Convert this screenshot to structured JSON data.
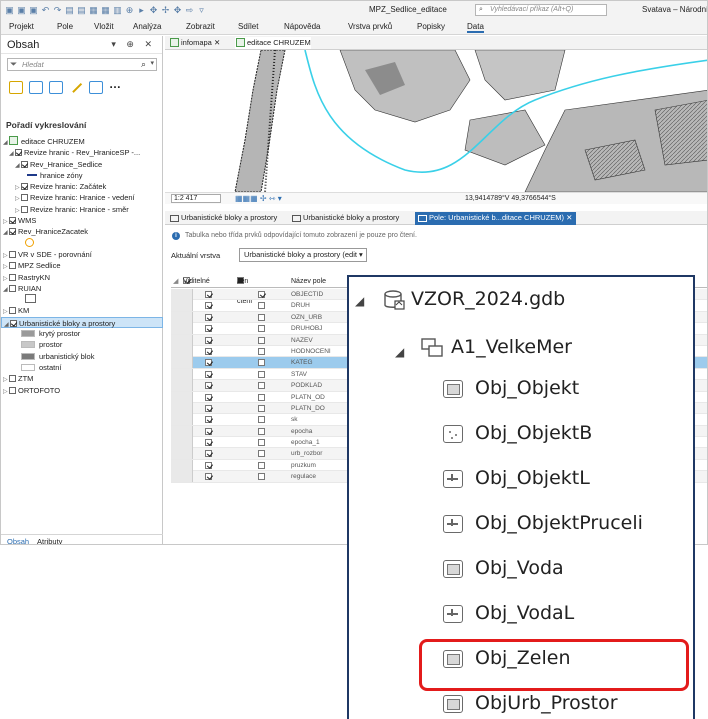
{
  "app": {
    "title": "MPZ_Sedlice_editace",
    "search_placeholder": "Vyhledávací příkaz (Alt+Q)",
    "user": "Svatava – Národní p"
  },
  "menu": [
    "Projekt",
    "Pole",
    "Vložit",
    "Analýza",
    "Zobrazit",
    "Sdílet",
    "Nápověda",
    "Vrstva prvků",
    "Popisky",
    "Data"
  ],
  "contents": {
    "title": "Obsah",
    "controls": "▾ ⊕ ✕",
    "search_placeholder": "Hledat",
    "draw_order": "Pořadí vykreslování",
    "tree": [
      {
        "label": "editace CHRUZEM",
        "indent": 0,
        "arrow": "◢",
        "cb": null,
        "icon": "map"
      },
      {
        "label": "Revize hranic - Rev_HraniceSP -...",
        "indent": 1,
        "arrow": "◢",
        "cb": true
      },
      {
        "label": "Rev_Hranice_Sedlice",
        "indent": 2,
        "arrow": "◢",
        "cb": true
      },
      {
        "label": "hranice zóny",
        "indent": 3,
        "arrow": "",
        "cb": null,
        "icon": "dash"
      },
      {
        "label": "Revize hranic: Začátek",
        "indent": 2,
        "arrow": "▷",
        "cb": true
      },
      {
        "label": "Revize hranic: Hranice - vedení",
        "indent": 2,
        "arrow": "▷",
        "cb": false
      },
      {
        "label": "Revize hranic: Hranice - směr",
        "indent": 2,
        "arrow": "▷",
        "cb": false
      },
      {
        "label": "WMS",
        "indent": 0,
        "arrow": "▷",
        "cb": true
      },
      {
        "label": "Rev_HraniceZacatek",
        "indent": 0,
        "arrow": "◢",
        "cb": true
      },
      {
        "label": "",
        "indent": 2,
        "arrow": "",
        "cb": null,
        "icon": "circle"
      },
      {
        "label": "VR v SDE - porovnání",
        "indent": 0,
        "arrow": "▷",
        "cb": false
      },
      {
        "label": "MPZ Sedlice",
        "indent": 0,
        "arrow": "▷",
        "cb": false
      },
      {
        "label": "RastryKN",
        "indent": 0,
        "arrow": "▷",
        "cb": false
      },
      {
        "label": "RUIAN",
        "indent": 0,
        "arrow": "◢",
        "cb": false
      },
      {
        "label": "",
        "indent": 2,
        "arrow": "",
        "cb": null,
        "icon": "square"
      },
      {
        "label": "KM",
        "indent": 0,
        "arrow": "▷",
        "cb": false
      },
      {
        "label": "Urbanistické bloky a prostory",
        "indent": 0,
        "arrow": "◢",
        "cb": true,
        "selected": true
      },
      {
        "label": "krytý prostor",
        "indent": 2,
        "arrow": "",
        "cb": null,
        "swatch": "#9a9a9a"
      },
      {
        "label": "prostor",
        "indent": 2,
        "arrow": "",
        "cb": null,
        "swatch": "#c8c8c8"
      },
      {
        "label": "urbanistický blok",
        "indent": 2,
        "arrow": "",
        "cb": null,
        "swatch": "#7a7a7a"
      },
      {
        "label": "ostatní",
        "indent": 2,
        "arrow": "",
        "cb": null,
        "swatch": "#ffffff"
      },
      {
        "label": "ZTM",
        "indent": 0,
        "arrow": "▷",
        "cb": false
      },
      {
        "label": "ORTOFOTO",
        "indent": 0,
        "arrow": "▷",
        "cb": false
      }
    ],
    "bottom_tabs": [
      "Obsah",
      "Atributy"
    ]
  },
  "map_tabs": [
    "infomapa",
    "editace CHRUZEM"
  ],
  "map_status": {
    "scale": "1:2 417",
    "coords": "13,9414789°V 49,3766544°S"
  },
  "table_tabs": [
    "Urbanistické bloky a prostory",
    "Urbanistické bloky a prostory",
    "Pole: Urbanistické b...ditace CHRUZEM)"
  ],
  "info_text": "Tabulka nebo třída prvků odpovídající tomuto zobrazení je pouze pro čtení.",
  "current_layer_label": "Aktuální vrstva",
  "current_layer_value": "Urbanistické bloky a prostory (edit",
  "fields_header": [
    "Viditelné",
    "Jen pro čtení",
    "Název pole"
  ],
  "fields": [
    {
      "name": "OBJECTID",
      "visible": true,
      "readonly": true,
      "side": ""
    },
    {
      "name": "DRUH",
      "visible": true,
      "readonly": false,
      "side": "stor"
    },
    {
      "name": "OZN_URB",
      "visible": true,
      "readonly": false,
      "side": ""
    },
    {
      "name": "DRUHOBJ",
      "visible": true,
      "readonly": false,
      "side": ""
    },
    {
      "name": "NAZEV",
      "visible": true,
      "readonly": false,
      "side": ""
    },
    {
      "name": "HODNOCENI",
      "visible": true,
      "readonly": false,
      "side": "ení"
    },
    {
      "name": "KATEG",
      "visible": true,
      "readonly": false,
      "side": "osto",
      "selected": true
    },
    {
      "name": "STAV",
      "visible": true,
      "readonly": false,
      "side": ""
    },
    {
      "name": "PODKLAD",
      "visible": true,
      "readonly": false,
      "side": ""
    },
    {
      "name": "PLATN_OD",
      "visible": true,
      "readonly": false,
      "side": ""
    },
    {
      "name": "PLATN_DO",
      "visible": true,
      "readonly": false,
      "side": ""
    },
    {
      "name": "sk",
      "visible": true,
      "readonly": false,
      "side": ""
    },
    {
      "name": "epocha",
      "visible": true,
      "readonly": false,
      "side": "Urb"
    },
    {
      "name": "epocha_1",
      "visible": true,
      "readonly": false,
      "side": "Urb"
    },
    {
      "name": "urb_rozbor",
      "visible": true,
      "readonly": false,
      "side": ""
    },
    {
      "name": "pruzkum",
      "visible": true,
      "readonly": false,
      "side": ""
    },
    {
      "name": "regulace",
      "visible": true,
      "readonly": false,
      "side": ""
    }
  ],
  "catalog": {
    "gdb": "VZOR_2024.gdb",
    "dataset": "A1_VelkeMer",
    "items": [
      {
        "label": "Obj_Objekt",
        "type": "poly"
      },
      {
        "label": "Obj_ObjektB",
        "type": "point"
      },
      {
        "label": "Obj_ObjektL",
        "type": "line"
      },
      {
        "label": "Obj_ObjektPruceli",
        "type": "line"
      },
      {
        "label": "Obj_Voda",
        "type": "poly"
      },
      {
        "label": "Obj_VodaL",
        "type": "line"
      },
      {
        "label": "Obj_Zelen",
        "type": "poly"
      },
      {
        "label": "ObjUrb_Prostor",
        "type": "poly",
        "highlighted": true
      }
    ],
    "highlight_color": "#e31b1b"
  }
}
